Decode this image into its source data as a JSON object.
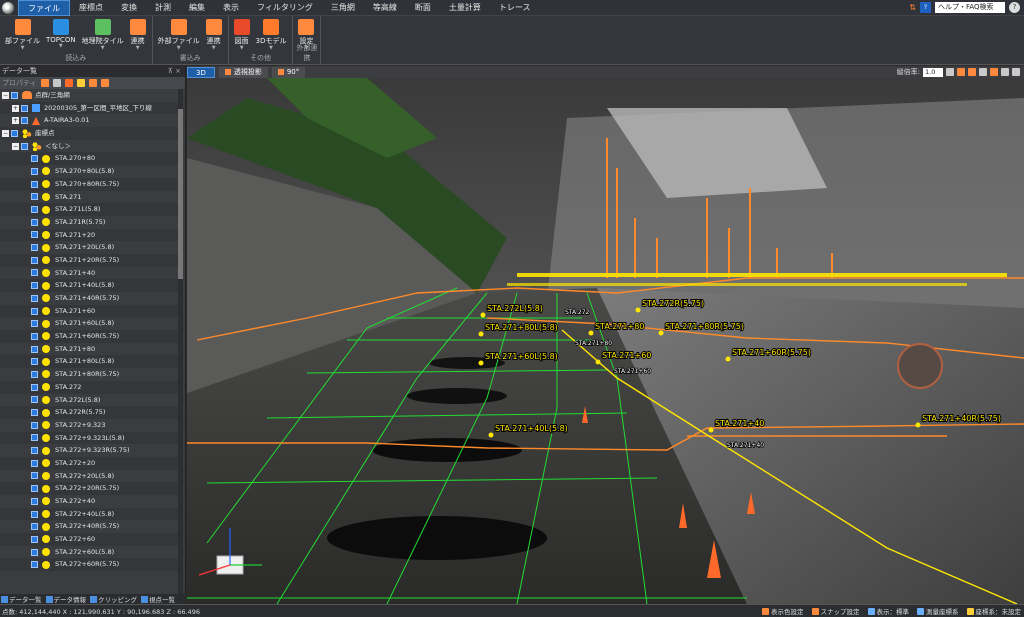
{
  "menubar": {
    "items": [
      "ファイル",
      "座標点",
      "変換",
      "計測",
      "編集",
      "表示",
      "フィルタリング",
      "三角網",
      "等高線",
      "断面",
      "土量計算",
      "トレース"
    ],
    "active_index": 0,
    "help_search_placeholder": "ヘルプ・FAQ検索"
  },
  "ribbon": {
    "groups": [
      {
        "title": "読込み",
        "buttons": [
          {
            "label": "部ファイル",
            "icon": "file-import-icon",
            "color": "#ff8a3d"
          },
          {
            "label": "TOPCON",
            "icon": "topcon-icon",
            "color": "#2a8fe0"
          },
          {
            "label": "地理院タイル",
            "icon": "map-tile-icon",
            "color": "#5cc060"
          },
          {
            "label": "連携",
            "icon": "link-icon",
            "color": "#ff8a3d"
          }
        ]
      },
      {
        "title": "書込み",
        "buttons": [
          {
            "label": "外部ファイル",
            "icon": "file-export-icon",
            "color": "#ff8a3d"
          },
          {
            "label": "連携",
            "icon": "link-export-icon",
            "color": "#ff8a3d"
          }
        ]
      },
      {
        "title": "その他",
        "buttons": [
          {
            "label": "図面",
            "icon": "cad-icon",
            "color": "#e84a2a"
          },
          {
            "label": "3Dモデル",
            "icon": "3d-model-icon",
            "color": "#ff7a2a"
          }
        ]
      },
      {
        "title": "外部連携",
        "buttons": [
          {
            "label": "設定",
            "icon": "gear-icon",
            "color": "#ff8a3d"
          }
        ]
      }
    ]
  },
  "left_panel": {
    "title": "データ一覧",
    "toolbar_label": "プロパティ",
    "tree": [
      {
        "level": 0,
        "kind": "group-cloud",
        "label": "点群/三角網"
      },
      {
        "level": 1,
        "kind": "file",
        "label": "20200305_第一区間_平地区_下り線"
      },
      {
        "level": 1,
        "kind": "tri",
        "label": "A-TAIRA3-0.01"
      },
      {
        "level": 0,
        "kind": "group-points",
        "label": "座標点"
      },
      {
        "level": 1,
        "kind": "group-points",
        "label": "＜なし＞"
      },
      {
        "level": 2,
        "kind": "point",
        "label": "STA.270+80"
      },
      {
        "level": 2,
        "kind": "point",
        "label": "STA.270+80L(5.8)"
      },
      {
        "level": 2,
        "kind": "point",
        "label": "STA.270+80R(5.75)"
      },
      {
        "level": 2,
        "kind": "point",
        "label": "STA.271"
      },
      {
        "level": 2,
        "kind": "point",
        "label": "STA.271L(5.8)"
      },
      {
        "level": 2,
        "kind": "point",
        "label": "STA.271R(5.75)"
      },
      {
        "level": 2,
        "kind": "point",
        "label": "STA.271+20"
      },
      {
        "level": 2,
        "kind": "point",
        "label": "STA.271+20L(5.8)"
      },
      {
        "level": 2,
        "kind": "point",
        "label": "STA.271+20R(5.75)"
      },
      {
        "level": 2,
        "kind": "point",
        "label": "STA.271+40"
      },
      {
        "level": 2,
        "kind": "point",
        "label": "STA.271+40L(5.8)"
      },
      {
        "level": 2,
        "kind": "point",
        "label": "STA.271+40R(5.75)"
      },
      {
        "level": 2,
        "kind": "point",
        "label": "STA.271+60"
      },
      {
        "level": 2,
        "kind": "point",
        "label": "STA.271+60L(5.8)"
      },
      {
        "level": 2,
        "kind": "point",
        "label": "STA.271+60R(5.75)"
      },
      {
        "level": 2,
        "kind": "point",
        "label": "STA.271+80"
      },
      {
        "level": 2,
        "kind": "point",
        "label": "STA.271+80L(5.8)"
      },
      {
        "level": 2,
        "kind": "point",
        "label": "STA.271+80R(5.75)"
      },
      {
        "level": 2,
        "kind": "point",
        "label": "STA.272"
      },
      {
        "level": 2,
        "kind": "point",
        "label": "STA.272L(5.8)"
      },
      {
        "level": 2,
        "kind": "point",
        "label": "STA.272R(5.75)"
      },
      {
        "level": 2,
        "kind": "point",
        "label": "STA.272+9.323"
      },
      {
        "level": 2,
        "kind": "point",
        "label": "STA.272+9.323L(5.8)"
      },
      {
        "level": 2,
        "kind": "point",
        "label": "STA.272+9.323R(5.75)"
      },
      {
        "level": 2,
        "kind": "point",
        "label": "STA.272+20"
      },
      {
        "level": 2,
        "kind": "point",
        "label": "STA.272+20L(5.8)"
      },
      {
        "level": 2,
        "kind": "point",
        "label": "STA.272+20R(5.75)"
      },
      {
        "level": 2,
        "kind": "point",
        "label": "STA.272+40"
      },
      {
        "level": 2,
        "kind": "point",
        "label": "STA.272+40L(5.8)"
      },
      {
        "level": 2,
        "kind": "point",
        "label": "STA.272+40R(5.75)"
      },
      {
        "level": 2,
        "kind": "point",
        "label": "STA.272+60"
      },
      {
        "level": 2,
        "kind": "point",
        "label": "STA.272+60L(5.8)"
      },
      {
        "level": 2,
        "kind": "point",
        "label": "STA.272+60R(5.75)"
      }
    ],
    "tabs": [
      "データ一覧",
      "データ情報",
      "クリッピング",
      "視点一覧"
    ]
  },
  "viewport": {
    "tab_3d": "3D",
    "btn_perspective": "透視投影",
    "btn_angle": "90°",
    "zoom_label": "縦倍率:",
    "zoom_value": "1.0",
    "labels": [
      {
        "text": "STA.272L(5.8)"
      },
      {
        "text": "STA.272R(5.75)"
      },
      {
        "text": "STA.271+80L(5.8)"
      },
      {
        "text": "STA.271+80"
      },
      {
        "text": "STA.271+80R(5.75)"
      },
      {
        "text": "STA.271+60L(5.8)"
      },
      {
        "text": "STA.271+60"
      },
      {
        "text": "STA.271+60R(5.75)"
      },
      {
        "text": "STA.271+40L(5.8)"
      },
      {
        "text": "STA.271+40"
      },
      {
        "text": "STA.271+40R(5.75)"
      }
    ],
    "small_labels": [
      "STA.271+80",
      "STA.271+60",
      "STA.271+40",
      "STA.272"
    ]
  },
  "statusbar": {
    "coords": "点数: 412,144,440    X : 121,990.631  Y : 90,196.683  Z : 66.496",
    "items": [
      {
        "label": "表示色設定",
        "icon": "color-settings-icon"
      },
      {
        "label": "スナップ設定",
        "icon": "snap-settings-icon"
      },
      {
        "label": "表示：標準",
        "icon": "display-mode-icon"
      },
      {
        "label": "測量座標系",
        "icon": "survey-coords-icon"
      },
      {
        "label": "座標系：未設定",
        "icon": "coord-system-icon"
      }
    ]
  },
  "colors": {
    "accent": "#1f5fa8",
    "point_yellow": "#ffe200",
    "grid_green": "#22dd33",
    "line_orange": "#ff8a2a"
  }
}
